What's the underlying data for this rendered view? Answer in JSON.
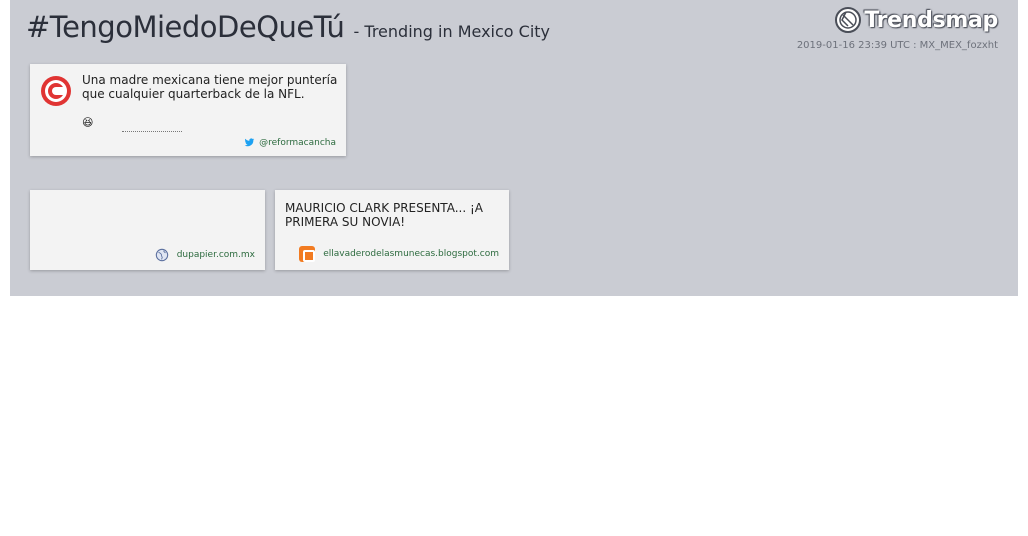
{
  "header": {
    "hashtag": "#TengoMiedoDeQueTú",
    "subtitle": "- Trending in Mexico City",
    "brand": "Trendsmap",
    "timestamp": "2019-01-16 23:39 UTC : MX_MEX_fozxht"
  },
  "tweet": {
    "text": " Una madre mexicana tiene mejor puntería que cualquier quarterback de la NFL.",
    "emoji": "😆",
    "handle": "@reformacancha",
    "avatar_icon": "cancha-logo-icon",
    "avatar_color": "#e03433"
  },
  "links": [
    {
      "title": "",
      "source": "dupapier.com.mx",
      "icon": "globe-icon"
    },
    {
      "title": "MAURICIO CLARK PRESENTA... ¡A PRIMERA SU NOVIA!",
      "source": "ellavaderodelasmunecas.blogspot.com",
      "icon": "blogger-icon"
    }
  ],
  "colors": {
    "panel": "#caccd3",
    "card": "#f3f3f3",
    "source_link": "#2d6b3f",
    "twitter": "#1da1f2"
  }
}
